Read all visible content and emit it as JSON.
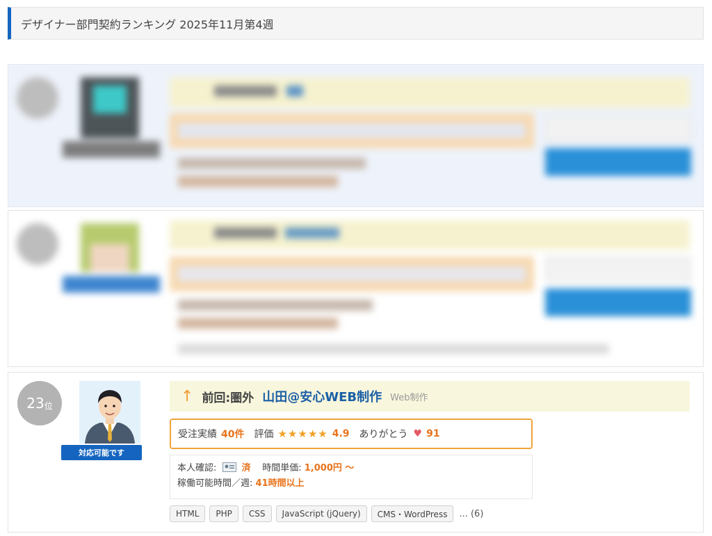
{
  "header": {
    "title": "デザイナー部門契約ランキング 2025年11月第4週"
  },
  "card3": {
    "rank_number": "23",
    "rank_unit": "位",
    "availability_badge": "対応可能です",
    "previous_rank": "前回:圏外",
    "designer_name": "山田@安心WEB制作",
    "category": "Web制作",
    "orders_label": "受注実績",
    "orders_value": "40件",
    "rating_label": "評価",
    "stars": "★★★★★",
    "rating_value": "4.9",
    "thanks_label": "ありがとう",
    "thanks_value": "91",
    "identity_label": "本人確認:",
    "identity_value": "済",
    "hourly_label": "時間単価:",
    "hourly_value": "1,000円 〜",
    "hours_label": "稼働可能時間／週:",
    "hours_value": "41時間以上",
    "skills": [
      "HTML",
      "PHP",
      "CSS",
      "JavaScript (jQuery)",
      "CMS・WordPress"
    ],
    "more_skills": "... (6)"
  },
  "icons": {
    "arrow": "arrow-up-icon",
    "heart": "heart-icon",
    "id_card": "id-card-icon",
    "star": "star-icon"
  },
  "colors": {
    "accent_blue": "#1565c0",
    "accent_orange": "#e8731b",
    "name_blue": "#1b5fa6",
    "highlight_bg": "#f8f6dc"
  }
}
